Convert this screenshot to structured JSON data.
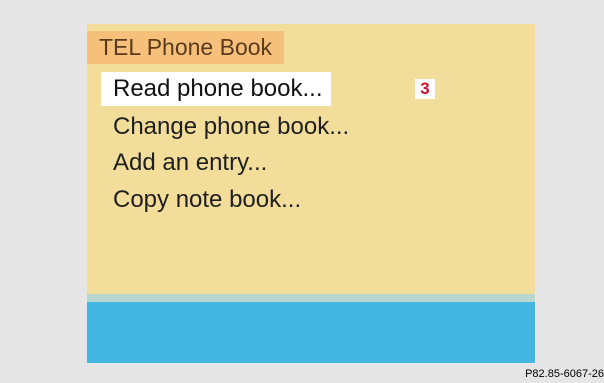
{
  "screen": {
    "title": "TEL Phone Book",
    "menu_items": [
      {
        "label": "Read phone book...",
        "selected": true
      },
      {
        "label": "Change phone book..."
      },
      {
        "label": "Add an entry..."
      },
      {
        "label": "Copy note book..."
      }
    ],
    "callout": "3"
  },
  "figure_id": "P82.85-6067-26",
  "colors": {
    "screen_background": "#f2dd9b",
    "title_background": "#f6c07a",
    "selected_background": "#ffffff",
    "bottom_bar": "#43b6e2",
    "callout_text": "#c8102e"
  }
}
